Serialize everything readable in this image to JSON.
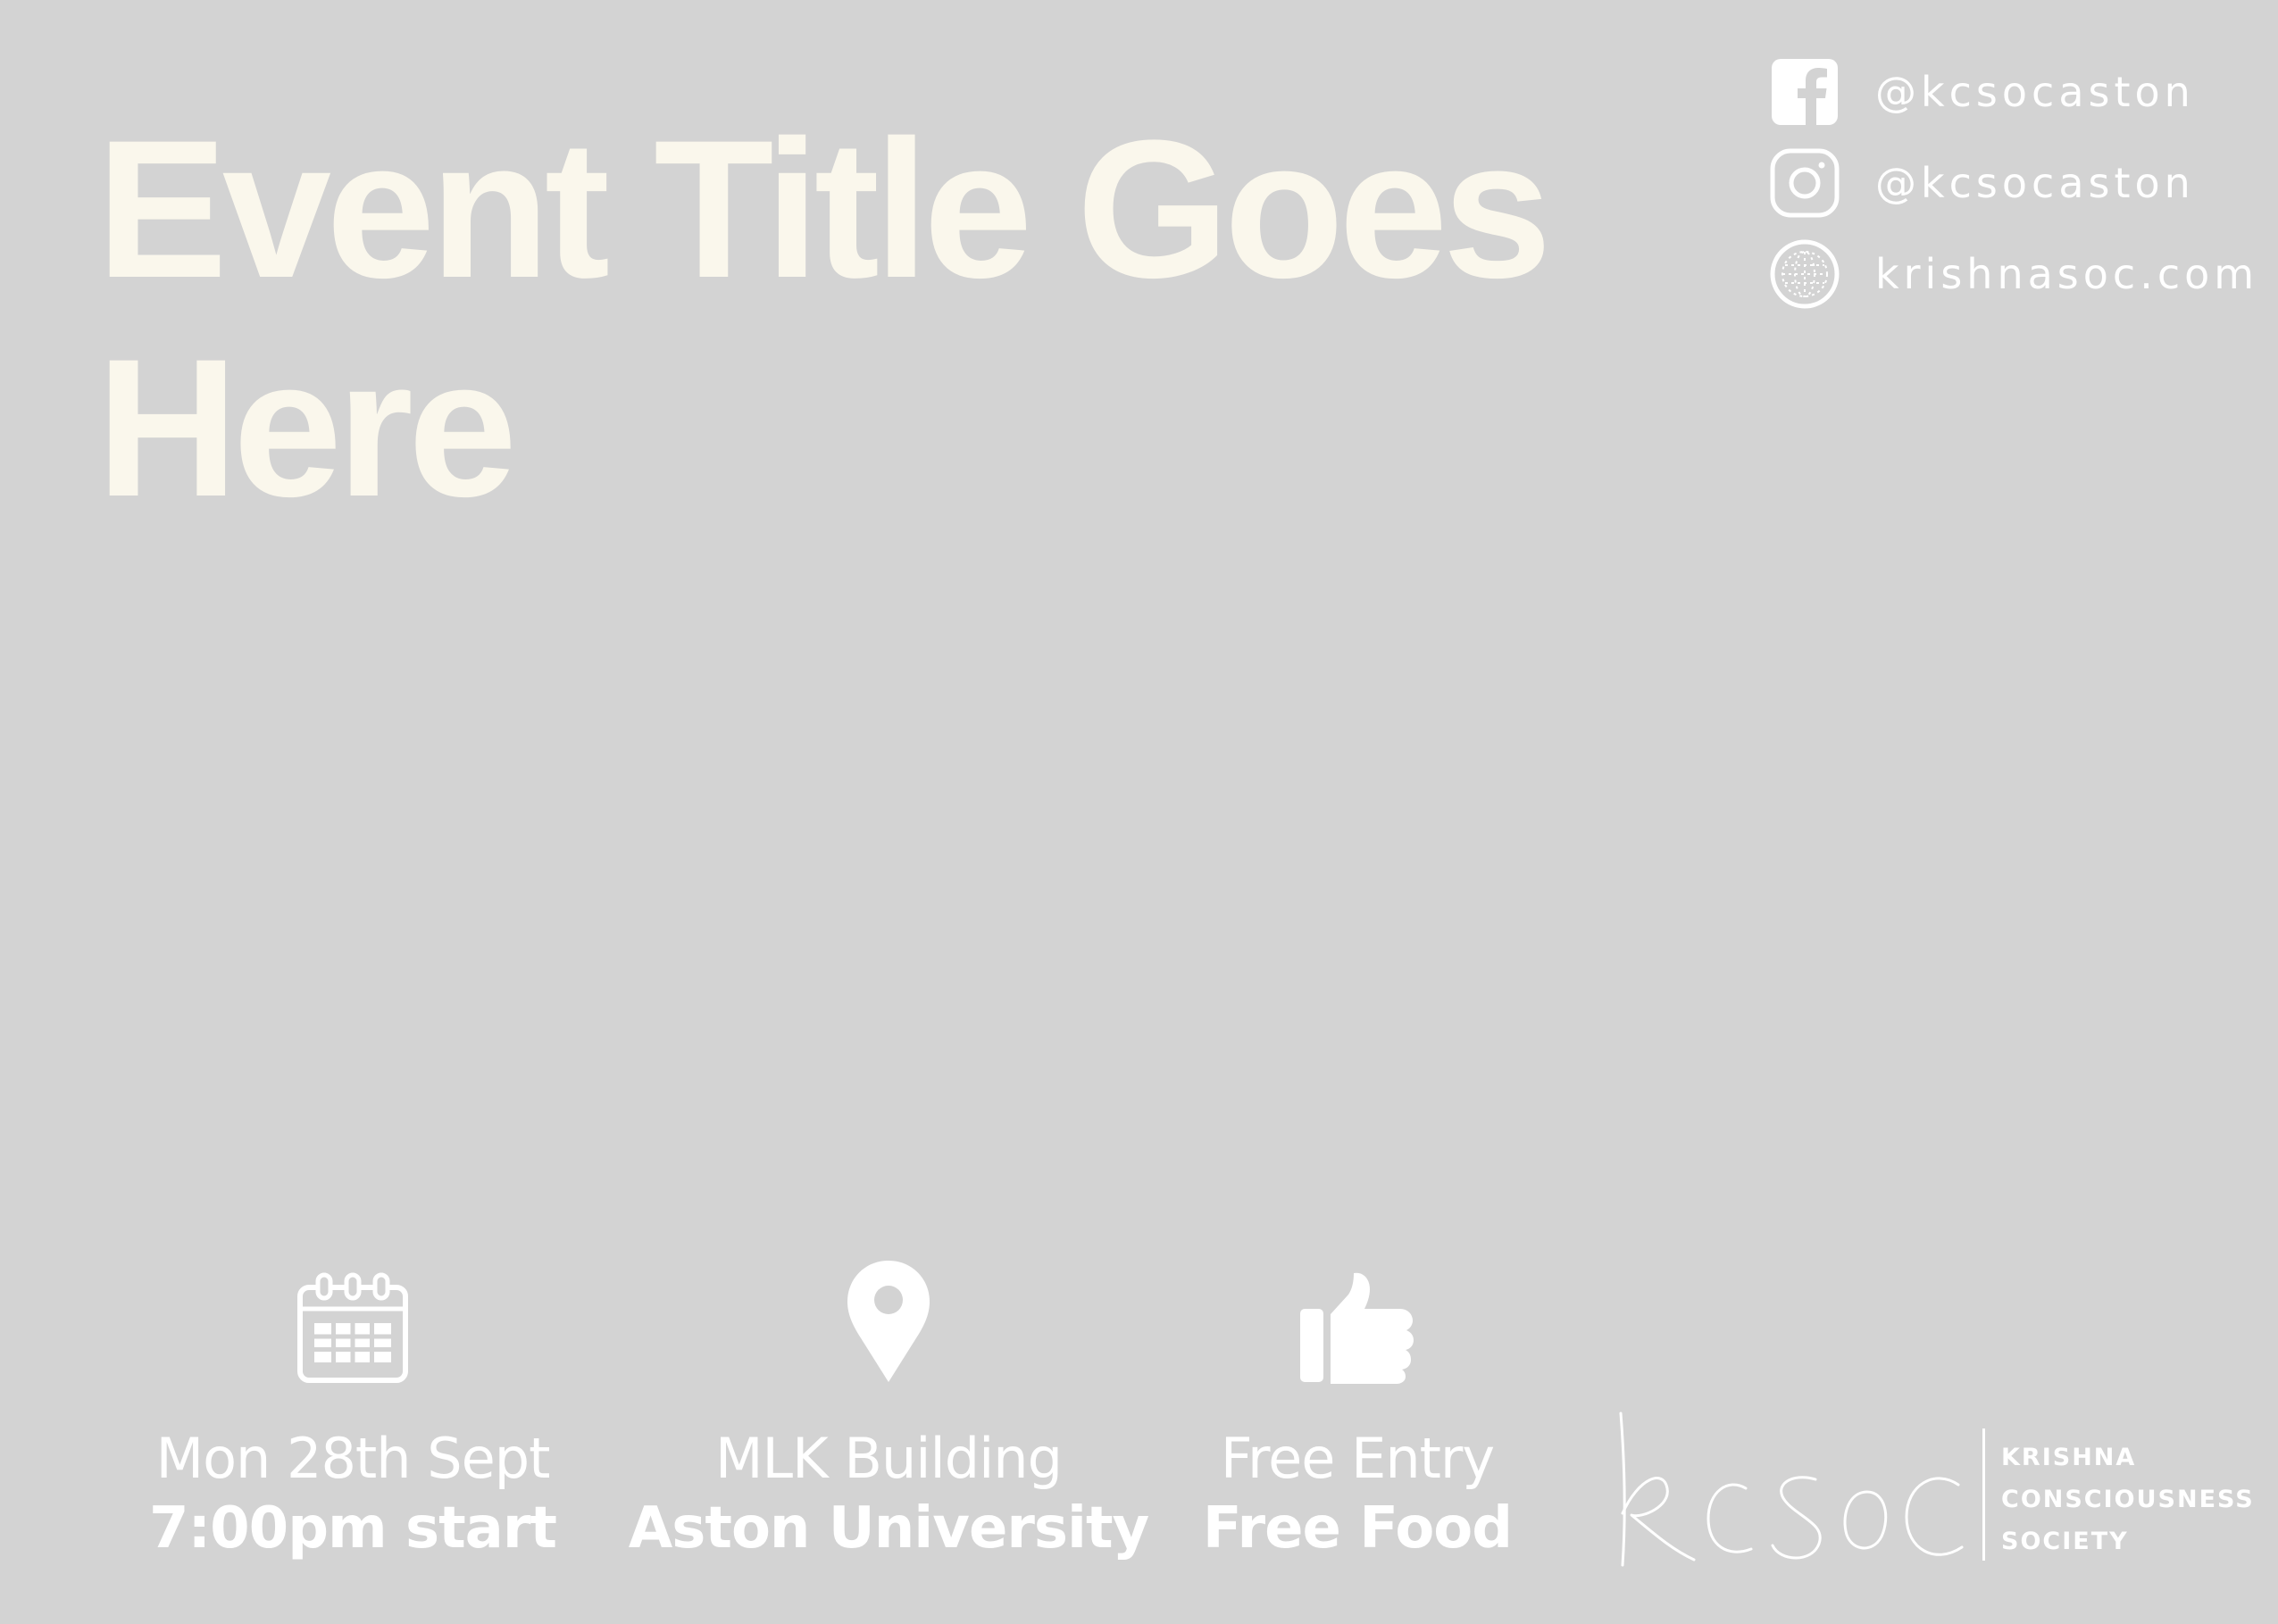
{
  "poster": {
    "title": "Event Title Goes Here",
    "colors": {
      "background": "#d3d3d3",
      "title": "#faf7ec",
      "text": "#ffffff"
    }
  },
  "social": [
    {
      "icon": "facebook-icon",
      "label": "@kcsocaston"
    },
    {
      "icon": "instagram-icon",
      "label": "@kcsocaston"
    },
    {
      "icon": "globe-icon",
      "label": "krishnasoc.com"
    }
  ],
  "info": {
    "date": {
      "icon": "calendar-icon",
      "line1": "Mon 28th Sept",
      "line2": "7:00pm start"
    },
    "venue": {
      "icon": "location-pin-icon",
      "line1": "MLK Building",
      "line2": "Aston University"
    },
    "free": {
      "icon": "thumbs-up-icon",
      "line1": "Free Entry",
      "line2": "Free Food"
    }
  },
  "logo": {
    "mark": "kcsoc",
    "org_lines": [
      "KRISHNA",
      "CONSCIOUSNESS",
      "SOCIETY"
    ]
  }
}
